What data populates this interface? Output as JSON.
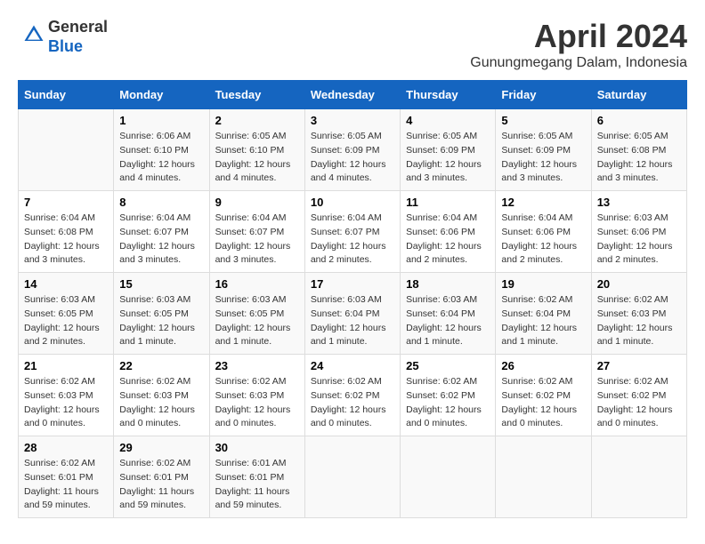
{
  "header": {
    "logo_line1": "General",
    "logo_line2": "Blue",
    "title": "April 2024",
    "subtitle": "Gunungmegang Dalam, Indonesia"
  },
  "calendar": {
    "days_of_week": [
      "Sunday",
      "Monday",
      "Tuesday",
      "Wednesday",
      "Thursday",
      "Friday",
      "Saturday"
    ],
    "weeks": [
      [
        {
          "day": "",
          "info": ""
        },
        {
          "day": "1",
          "info": "Sunrise: 6:06 AM\nSunset: 6:10 PM\nDaylight: 12 hours\nand 4 minutes."
        },
        {
          "day": "2",
          "info": "Sunrise: 6:05 AM\nSunset: 6:10 PM\nDaylight: 12 hours\nand 4 minutes."
        },
        {
          "day": "3",
          "info": "Sunrise: 6:05 AM\nSunset: 6:09 PM\nDaylight: 12 hours\nand 4 minutes."
        },
        {
          "day": "4",
          "info": "Sunrise: 6:05 AM\nSunset: 6:09 PM\nDaylight: 12 hours\nand 3 minutes."
        },
        {
          "day": "5",
          "info": "Sunrise: 6:05 AM\nSunset: 6:09 PM\nDaylight: 12 hours\nand 3 minutes."
        },
        {
          "day": "6",
          "info": "Sunrise: 6:05 AM\nSunset: 6:08 PM\nDaylight: 12 hours\nand 3 minutes."
        }
      ],
      [
        {
          "day": "7",
          "info": "Sunrise: 6:04 AM\nSunset: 6:08 PM\nDaylight: 12 hours\nand 3 minutes."
        },
        {
          "day": "8",
          "info": "Sunrise: 6:04 AM\nSunset: 6:07 PM\nDaylight: 12 hours\nand 3 minutes."
        },
        {
          "day": "9",
          "info": "Sunrise: 6:04 AM\nSunset: 6:07 PM\nDaylight: 12 hours\nand 3 minutes."
        },
        {
          "day": "10",
          "info": "Sunrise: 6:04 AM\nSunset: 6:07 PM\nDaylight: 12 hours\nand 2 minutes."
        },
        {
          "day": "11",
          "info": "Sunrise: 6:04 AM\nSunset: 6:06 PM\nDaylight: 12 hours\nand 2 minutes."
        },
        {
          "day": "12",
          "info": "Sunrise: 6:04 AM\nSunset: 6:06 PM\nDaylight: 12 hours\nand 2 minutes."
        },
        {
          "day": "13",
          "info": "Sunrise: 6:03 AM\nSunset: 6:06 PM\nDaylight: 12 hours\nand 2 minutes."
        }
      ],
      [
        {
          "day": "14",
          "info": "Sunrise: 6:03 AM\nSunset: 6:05 PM\nDaylight: 12 hours\nand 2 minutes."
        },
        {
          "day": "15",
          "info": "Sunrise: 6:03 AM\nSunset: 6:05 PM\nDaylight: 12 hours\nand 1 minute."
        },
        {
          "day": "16",
          "info": "Sunrise: 6:03 AM\nSunset: 6:05 PM\nDaylight: 12 hours\nand 1 minute."
        },
        {
          "day": "17",
          "info": "Sunrise: 6:03 AM\nSunset: 6:04 PM\nDaylight: 12 hours\nand 1 minute."
        },
        {
          "day": "18",
          "info": "Sunrise: 6:03 AM\nSunset: 6:04 PM\nDaylight: 12 hours\nand 1 minute."
        },
        {
          "day": "19",
          "info": "Sunrise: 6:02 AM\nSunset: 6:04 PM\nDaylight: 12 hours\nand 1 minute."
        },
        {
          "day": "20",
          "info": "Sunrise: 6:02 AM\nSunset: 6:03 PM\nDaylight: 12 hours\nand 1 minute."
        }
      ],
      [
        {
          "day": "21",
          "info": "Sunrise: 6:02 AM\nSunset: 6:03 PM\nDaylight: 12 hours\nand 0 minutes."
        },
        {
          "day": "22",
          "info": "Sunrise: 6:02 AM\nSunset: 6:03 PM\nDaylight: 12 hours\nand 0 minutes."
        },
        {
          "day": "23",
          "info": "Sunrise: 6:02 AM\nSunset: 6:03 PM\nDaylight: 12 hours\nand 0 minutes."
        },
        {
          "day": "24",
          "info": "Sunrise: 6:02 AM\nSunset: 6:02 PM\nDaylight: 12 hours\nand 0 minutes."
        },
        {
          "day": "25",
          "info": "Sunrise: 6:02 AM\nSunset: 6:02 PM\nDaylight: 12 hours\nand 0 minutes."
        },
        {
          "day": "26",
          "info": "Sunrise: 6:02 AM\nSunset: 6:02 PM\nDaylight: 12 hours\nand 0 minutes."
        },
        {
          "day": "27",
          "info": "Sunrise: 6:02 AM\nSunset: 6:02 PM\nDaylight: 12 hours\nand 0 minutes."
        }
      ],
      [
        {
          "day": "28",
          "info": "Sunrise: 6:02 AM\nSunset: 6:01 PM\nDaylight: 11 hours\nand 59 minutes."
        },
        {
          "day": "29",
          "info": "Sunrise: 6:02 AM\nSunset: 6:01 PM\nDaylight: 11 hours\nand 59 minutes."
        },
        {
          "day": "30",
          "info": "Sunrise: 6:01 AM\nSunset: 6:01 PM\nDaylight: 11 hours\nand 59 minutes."
        },
        {
          "day": "",
          "info": ""
        },
        {
          "day": "",
          "info": ""
        },
        {
          "day": "",
          "info": ""
        },
        {
          "day": "",
          "info": ""
        }
      ]
    ]
  }
}
